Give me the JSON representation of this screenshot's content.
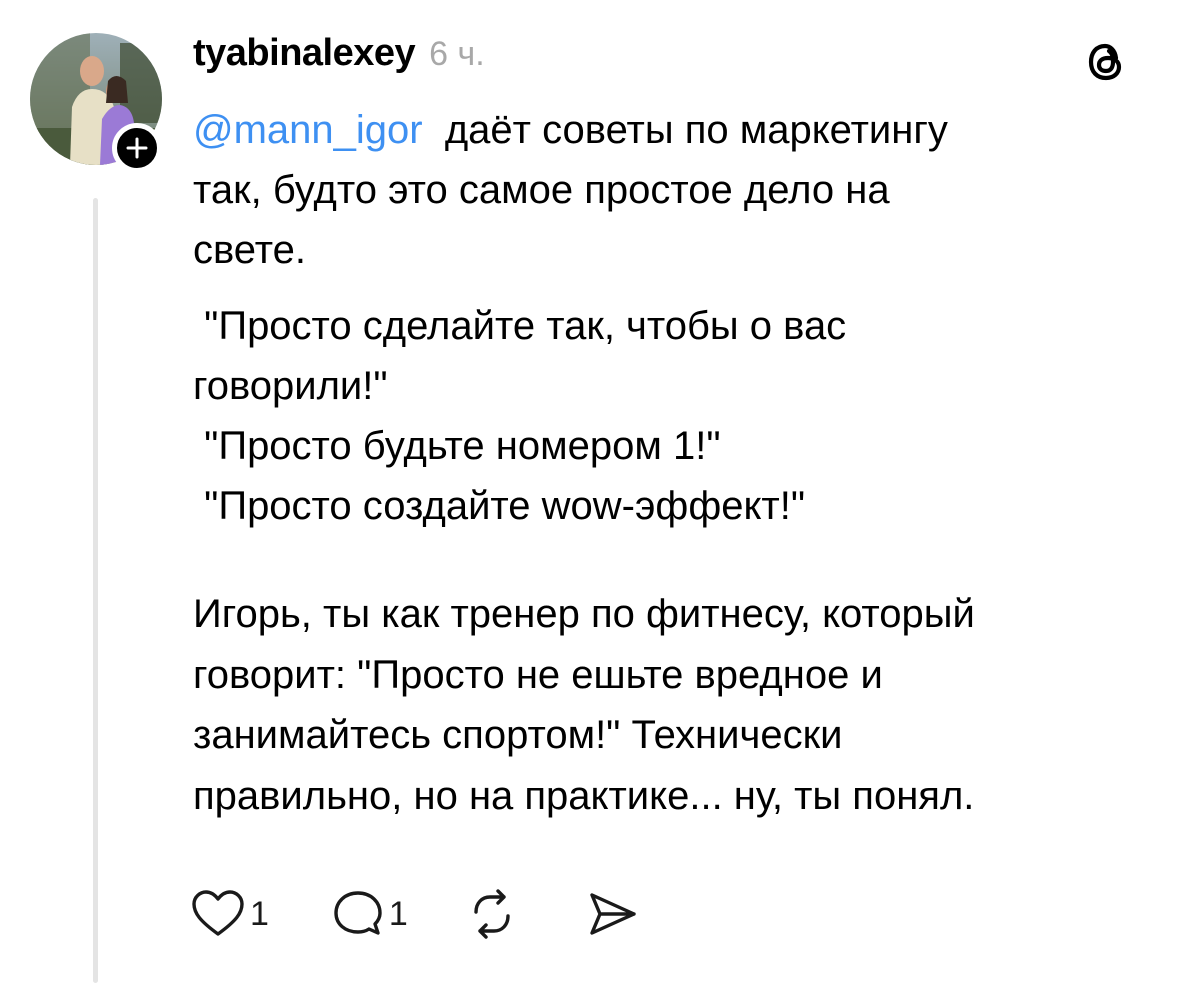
{
  "post": {
    "author": "tyabinalexey",
    "time": "6 ч.",
    "mention": "@mann_igor",
    "para1_rest": "  даёт советы по маркетингу",
    "para1_line2": "так, будто это самое простое дело на",
    "para1_line3": "свете.",
    "quote1_a": " \"Просто сделайте так, чтобы о вас",
    "quote1_b": "говорили!\"",
    "quote2": " \"Просто будьте номером 1!\"",
    "quote3": " \"Просто создайте wow-эффект!\"",
    "para3_lines": [
      "Игорь, ты как тренер по фитнесу, который",
      "говорит: \"Просто не ешьте вредное и",
      "занимайтесь спортом!\" Технически",
      "правильно, но на практике... ну, ты понял."
    ]
  },
  "actions": {
    "likes": "1",
    "replies": "1"
  },
  "icons": {
    "like": "heart-icon",
    "reply": "comment-icon",
    "repost": "repost-icon",
    "share": "send-icon",
    "logo": "threads-logo-icon",
    "follow": "plus-icon"
  }
}
